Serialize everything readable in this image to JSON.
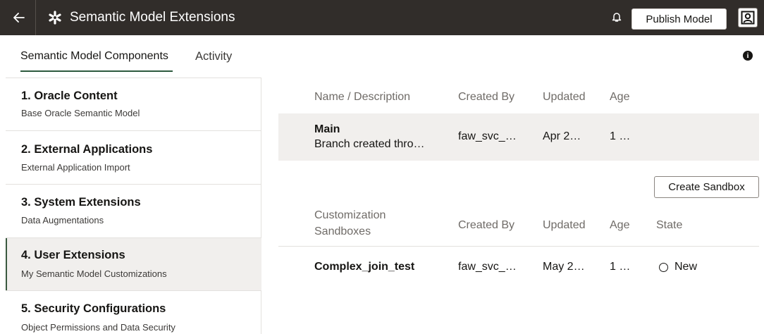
{
  "header": {
    "title": "Semantic Model Extensions",
    "publish_label": "Publish Model",
    "back_icon": "arrow-left-icon",
    "app_icon": "asterisk-icon",
    "bell_icon": "bell-icon",
    "profile_icon": "user-profile-icon",
    "bg_color": "#312d2a"
  },
  "tabs": [
    {
      "label": "Semantic Model Components",
      "active": true
    },
    {
      "label": "Activity",
      "active": false
    }
  ],
  "sidebar": {
    "items": [
      {
        "title": "1. Oracle Content",
        "subtitle": "Base Oracle Semantic Model",
        "active": false
      },
      {
        "title": "2. External Applications",
        "subtitle": "External Application Import",
        "active": false
      },
      {
        "title": "3. System Extensions",
        "subtitle": "Data Augmentations",
        "active": false
      },
      {
        "title": "4. User Extensions",
        "subtitle": "My Semantic Model Customizations",
        "active": true
      },
      {
        "title": "5. Security Configurations",
        "subtitle": "Object Permissions and Data Security",
        "active": false
      }
    ]
  },
  "branches": {
    "headers": {
      "name": "Name / Description",
      "created_by": "Created By",
      "updated": "Updated",
      "age": "Age"
    },
    "rows": [
      {
        "name": "Main",
        "description": "Branch created thro…",
        "created_by": "faw_svc_…",
        "updated": "Apr 2…",
        "age": "1 …"
      }
    ]
  },
  "sandboxes": {
    "create_label": "Create Sandbox",
    "headers": {
      "name_line1": "Customization",
      "name_line2": "Sandboxes",
      "created_by": "Created By",
      "updated": "Updated",
      "age": "Age",
      "state": "State"
    },
    "rows": [
      {
        "name": "Complex_join_test",
        "created_by": "faw_svc_…",
        "updated": "May 2…",
        "age": "1 …",
        "state": "New"
      }
    ]
  }
}
